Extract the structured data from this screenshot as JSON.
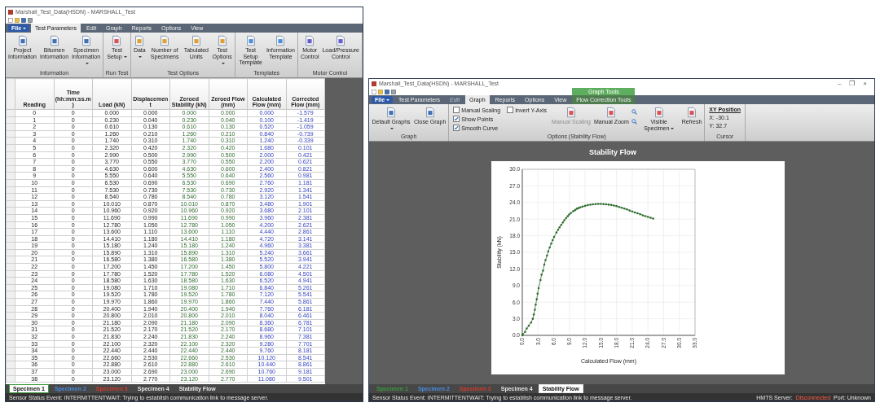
{
  "left_window": {
    "title": "Marshall_Test_Data(HSDN) - MARSHALL_Test",
    "file_menu": "File",
    "tabs": [
      {
        "label": "Test Parameters",
        "selected": true
      },
      {
        "label": "Edit",
        "selected": false
      },
      {
        "label": "Graph",
        "selected": false
      },
      {
        "label": "Reports",
        "selected": false
      },
      {
        "label": "Options",
        "selected": false
      },
      {
        "label": "View",
        "selected": false
      }
    ],
    "ribbon_groups": [
      {
        "label": "Information",
        "items": [
          {
            "kind": "button",
            "label": "Project Information",
            "dropdown": false
          },
          {
            "kind": "button",
            "label": "Bitumen Information",
            "dropdown": false
          },
          {
            "kind": "button",
            "label": "Specimen Information",
            "dropdown": true
          }
        ]
      },
      {
        "label": "Run Test",
        "items": [
          {
            "kind": "button",
            "label": "Test Setup",
            "dropdown": true
          }
        ]
      },
      {
        "label": "Test Options",
        "items": [
          {
            "kind": "button",
            "label": "Data",
            "dropdown": true
          },
          {
            "kind": "button",
            "label": "Number of Specimens",
            "dropdown": false
          },
          {
            "kind": "button",
            "label": "Tabulated Units",
            "dropdown": false
          },
          {
            "kind": "button",
            "label": "Test Options",
            "dropdown": true
          }
        ]
      },
      {
        "label": "Templates",
        "items": [
          {
            "kind": "button",
            "label": "Test Setup Template",
            "dropdown": false
          },
          {
            "kind": "button",
            "label": "Information Template",
            "dropdown": false
          }
        ]
      },
      {
        "label": "Motor Control",
        "items": [
          {
            "kind": "button",
            "label": "Motor Control",
            "dropdown": false
          },
          {
            "kind": "button",
            "label": "Load/Pressure Control",
            "dropdown": false
          }
        ]
      }
    ],
    "table": {
      "columns": [
        {
          "label": "Reading",
          "kind": "raw"
        },
        {
          "label": "Time (hh:mm:ss.m)",
          "kind": "raw"
        },
        {
          "label": "Load (kN)",
          "kind": "raw"
        },
        {
          "label": "Displacement",
          "kind": "raw"
        },
        {
          "label": "Zeroed Stability (kN)",
          "kind": "zeroed"
        },
        {
          "label": "Zeroed Flow (mm)",
          "kind": "zeroed"
        },
        {
          "label": "Calculated Flow (mm)",
          "kind": "computed"
        },
        {
          "label": "Corrected Flow (mm)",
          "kind": "computed"
        }
      ],
      "rows": [
        [
          "0",
          "0",
          "0.000",
          "0.000",
          "0.000",
          "0.000",
          "0.000",
          "-1.579"
        ],
        [
          "1",
          "0",
          "0.230",
          "0.040",
          "0.230",
          "0.040",
          "0.100",
          "-1.419"
        ],
        [
          "2",
          "0",
          "0.610",
          "0.130",
          "0.610",
          "0.130",
          "0.520",
          "-1.059"
        ],
        [
          "3",
          "0",
          "1.260",
          "0.210",
          "1.260",
          "0.210",
          "0.840",
          "-0.739"
        ],
        [
          "4",
          "0",
          "1.740",
          "0.310",
          "1.740",
          "0.310",
          "1.240",
          "-0.339"
        ],
        [
          "5",
          "0",
          "2.320",
          "0.420",
          "2.320",
          "0.420",
          "1.680",
          "0.101"
        ],
        [
          "6",
          "0",
          "2.990",
          "0.500",
          "2.990",
          "0.500",
          "2.000",
          "0.421"
        ],
        [
          "7",
          "0",
          "3.770",
          "0.550",
          "3.770",
          "0.550",
          "2.200",
          "0.621"
        ],
        [
          "8",
          "0",
          "4.630",
          "0.600",
          "4.630",
          "0.600",
          "2.400",
          "0.821"
        ],
        [
          "9",
          "0",
          "5.550",
          "0.640",
          "5.550",
          "0.640",
          "2.560",
          "0.981"
        ],
        [
          "10",
          "0",
          "6.530",
          "0.690",
          "6.530",
          "0.690",
          "2.760",
          "1.181"
        ],
        [
          "11",
          "0",
          "7.530",
          "0.730",
          "7.530",
          "0.730",
          "2.920",
          "1.341"
        ],
        [
          "12",
          "0",
          "8.540",
          "0.780",
          "8.540",
          "0.780",
          "3.120",
          "1.541"
        ],
        [
          "13",
          "0",
          "10.010",
          "0.870",
          "10.010",
          "0.870",
          "3.480",
          "1.901"
        ],
        [
          "14",
          "0",
          "10.960",
          "0.920",
          "10.960",
          "0.920",
          "3.680",
          "2.101"
        ],
        [
          "15",
          "0",
          "11.690",
          "0.990",
          "11.690",
          "0.990",
          "3.960",
          "2.381"
        ],
        [
          "16",
          "0",
          "12.780",
          "1.050",
          "12.780",
          "1.050",
          "4.200",
          "2.621"
        ],
        [
          "17",
          "0",
          "13.600",
          "1.110",
          "13.600",
          "1.110",
          "4.440",
          "2.861"
        ],
        [
          "18",
          "0",
          "14.410",
          "1.180",
          "14.410",
          "1.180",
          "4.720",
          "3.141"
        ],
        [
          "19",
          "0",
          "15.180",
          "1.240",
          "15.180",
          "1.240",
          "4.960",
          "3.381"
        ],
        [
          "20",
          "0",
          "15.890",
          "1.310",
          "15.890",
          "1.310",
          "5.240",
          "3.661"
        ],
        [
          "21",
          "0",
          "16.580",
          "1.380",
          "16.580",
          "1.380",
          "5.520",
          "3.941"
        ],
        [
          "22",
          "0",
          "17.200",
          "1.450",
          "17.200",
          "1.450",
          "5.800",
          "4.221"
        ],
        [
          "23",
          "0",
          "17.780",
          "1.520",
          "17.780",
          "1.520",
          "6.080",
          "4.501"
        ],
        [
          "24",
          "0",
          "18.580",
          "1.630",
          "18.580",
          "1.630",
          "6.520",
          "4.941"
        ],
        [
          "25",
          "0",
          "19.080",
          "1.710",
          "19.080",
          "1.710",
          "6.840",
          "5.261"
        ],
        [
          "26",
          "0",
          "19.520",
          "1.780",
          "19.520",
          "1.780",
          "7.120",
          "5.541"
        ],
        [
          "27",
          "0",
          "19.970",
          "1.860",
          "19.970",
          "1.860",
          "7.440",
          "5.861"
        ],
        [
          "28",
          "0",
          "20.400",
          "1.940",
          "20.400",
          "1.940",
          "7.760",
          "6.181"
        ],
        [
          "29",
          "0",
          "20.800",
          "2.010",
          "20.800",
          "2.010",
          "8.040",
          "6.461"
        ],
        [
          "30",
          "0",
          "21.180",
          "2.090",
          "21.180",
          "2.090",
          "8.360",
          "6.781"
        ],
        [
          "31",
          "0",
          "21.520",
          "2.170",
          "21.520",
          "2.170",
          "8.680",
          "7.101"
        ],
        [
          "32",
          "0",
          "21.830",
          "2.240",
          "21.830",
          "2.240",
          "8.960",
          "7.381"
        ],
        [
          "33",
          "0",
          "22.100",
          "2.320",
          "22.100",
          "2.320",
          "9.280",
          "7.701"
        ],
        [
          "34",
          "0",
          "22.440",
          "2.440",
          "22.440",
          "2.440",
          "9.760",
          "8.181"
        ],
        [
          "35",
          "0",
          "22.660",
          "2.530",
          "22.660",
          "2.530",
          "10.120",
          "8.541"
        ],
        [
          "36",
          "0",
          "22.880",
          "2.610",
          "22.880",
          "2.610",
          "10.440",
          "8.861"
        ],
        [
          "37",
          "0",
          "23.000",
          "2.690",
          "23.000",
          "2.690",
          "10.760",
          "9.181"
        ],
        [
          "38",
          "0",
          "23.120",
          "2.770",
          "23.120",
          "2.770",
          "11.080",
          "9.501"
        ]
      ]
    },
    "sheet_tabs": [
      {
        "label": "Specimen 1",
        "selected": true,
        "color": "#3a9a3a"
      },
      {
        "label": "Specimen 2",
        "selected": false,
        "color": "#4a8be0"
      },
      {
        "label": "Specimen 3",
        "selected": false,
        "color": "#d23a2a"
      },
      {
        "label": "Specimen 4",
        "selected": false,
        "color": "#e6e6e6"
      },
      {
        "label": "Stability Flow",
        "selected": false,
        "color": "#e6e6e6"
      }
    ],
    "status_bar": {
      "text": "Sensor Status Event: INTERMITTENTWAIT: Trying to establish communication link to message server."
    }
  },
  "right_window": {
    "title": "Marshall_Test_Data(HSDN) - MARSHALL_Test",
    "window_controls": [
      "–",
      "❐",
      "×"
    ],
    "file_menu": "File",
    "tabs": [
      {
        "label": "Test Parameters",
        "selected": false,
        "disabled": false
      },
      {
        "label": "Edit",
        "selected": false,
        "disabled": true
      },
      {
        "label": "Graph",
        "selected": true,
        "disabled": false
      },
      {
        "label": "Reports",
        "selected": false,
        "disabled": false
      },
      {
        "label": "Options",
        "selected": false,
        "disabled": false
      },
      {
        "label": "View",
        "selected": false,
        "disabled": false
      },
      {
        "label": "Flow Correction Tools",
        "selected": false,
        "disabled": false,
        "context": "Graph Tools"
      }
    ],
    "ribbon_groups": [
      {
        "label": "Graph",
        "items": [
          {
            "kind": "button",
            "label": "Default Graphs",
            "dropdown": true,
            "disabled": false
          },
          {
            "kind": "button",
            "label": "Close Graph",
            "dropdown": false,
            "disabled": false
          }
        ]
      },
      {
        "label": "Options (Stability Flow)",
        "items": [
          {
            "kind": "stack",
            "items": [
              {
                "kind": "checkbox",
                "label": "Manual Scaling",
                "checked": false
              },
              {
                "kind": "checkbox",
                "label": "Show Points",
                "checked": true
              },
              {
                "kind": "checkbox",
                "label": "Smooth Curve",
                "checked": true
              }
            ]
          },
          {
            "kind": "stack",
            "items": [
              {
                "kind": "checkbox",
                "label": "Invert Y-Axis",
                "checked": false
              }
            ]
          },
          {
            "kind": "button",
            "label": "Manual Scaling",
            "dropdown": false,
            "disabled": true
          },
          {
            "kind": "button",
            "label": "Manual Zoom",
            "dropdown": false,
            "disabled": false
          },
          {
            "kind": "zoom"
          },
          {
            "kind": "button",
            "label": "Visible Specimen",
            "dropdown": true,
            "disabled": false
          },
          {
            "kind": "button",
            "label": "Refresh",
            "dropdown": false,
            "disabled": false
          }
        ]
      },
      {
        "label": "Cursor",
        "items": [
          {
            "kind": "stack",
            "items": [
              {
                "kind": "heading",
                "label": "XY Position"
              },
              {
                "kind": "value",
                "label": "X: -30.1"
              },
              {
                "kind": "value",
                "label": "Y: 32.7"
              }
            ]
          }
        ]
      }
    ],
    "chart_data": {
      "type": "line",
      "title": "Stability Flow",
      "xlabel": "Calculated Flow (mm)",
      "ylabel": "Stability (kN)",
      "x": [
        0,
        0.1,
        0.52,
        0.84,
        1.24,
        1.68,
        2,
        2.2,
        2.4,
        2.56,
        2.76,
        2.92,
        3.12,
        3.48,
        3.68,
        3.96,
        4.2,
        4.44,
        4.72,
        4.96,
        5.24,
        5.52,
        5.8,
        6.08,
        6.52,
        6.84,
        7.12,
        7.44,
        7.76,
        8.04,
        8.36,
        8.68,
        8.96,
        9.28,
        9.76,
        10.12,
        10.44,
        10.76,
        11.08,
        11.5,
        12,
        12.5,
        13,
        13.5,
        14,
        14.5,
        15,
        15.5,
        16,
        16.5,
        17,
        17.5,
        18,
        18.5,
        19,
        19.5,
        20,
        20.5,
        21,
        21.5,
        22,
        22.5,
        23,
        23.5,
        24,
        24.5,
        25
      ],
      "grid": true,
      "series": [
        {
          "color": "#2f6e2f",
          "values": [
            0,
            0.23,
            0.61,
            1.26,
            1.74,
            2.32,
            2.99,
            3.77,
            4.63,
            5.55,
            6.53,
            7.53,
            8.54,
            10.01,
            10.96,
            11.69,
            12.78,
            13.6,
            14.41,
            15.18,
            15.89,
            16.58,
            17.2,
            17.78,
            18.58,
            19.08,
            19.52,
            19.97,
            20.4,
            20.8,
            21.18,
            21.52,
            21.83,
            22.1,
            22.44,
            22.66,
            22.88,
            23,
            23.12,
            23.26,
            23.4,
            23.52,
            23.61,
            23.68,
            23.72,
            23.74,
            23.74,
            23.72,
            23.68,
            23.62,
            23.55,
            23.46,
            23.36,
            23.2,
            23.05,
            22.9,
            22.75,
            22.55,
            22.4,
            22.2,
            22.05,
            21.9,
            21.7,
            21.55,
            21.4,
            21.25,
            21.1
          ]
        }
      ],
      "xlim": [
        0,
        33
      ],
      "ylim": [
        0,
        30
      ],
      "xticks": [
        {
          "value": 0,
          "label": "0.0"
        },
        {
          "value": 3,
          "label": "3.0"
        },
        {
          "value": 6,
          "label": "6.0"
        },
        {
          "value": 9,
          "label": "9.0"
        },
        {
          "value": 12,
          "label": "12.0"
        },
        {
          "value": 15,
          "label": "15.0"
        },
        {
          "value": 18,
          "label": "18.0"
        },
        {
          "value": 21,
          "label": "21.0"
        },
        {
          "value": 24,
          "label": "24.0"
        },
        {
          "value": 27,
          "label": "27.0"
        },
        {
          "value": 30,
          "label": "30.0"
        },
        {
          "value": 33,
          "label": "33.0"
        }
      ],
      "yticks": [
        {
          "value": 0,
          "label": "0.0"
        },
        {
          "value": 3,
          "label": "3.0"
        },
        {
          "value": 6,
          "label": "6.0"
        },
        {
          "value": 9,
          "label": "9.0"
        },
        {
          "value": 12,
          "label": "12.0"
        },
        {
          "value": 15,
          "label": "15.0"
        },
        {
          "value": 18,
          "label": "18.0"
        },
        {
          "value": 21,
          "label": "21.0"
        },
        {
          "value": 24,
          "label": "24.0"
        },
        {
          "value": 27,
          "label": "27.0"
        },
        {
          "value": 30,
          "label": "30.0"
        }
      ]
    },
    "sheet_tabs": [
      {
        "label": "Specimen 1",
        "selected": false,
        "color": "#3a9a3a"
      },
      {
        "label": "Specimen 2",
        "selected": false,
        "color": "#4a8be0"
      },
      {
        "label": "Specimen 3",
        "selected": false,
        "color": "#d23a2a"
      },
      {
        "label": "Specimen 4",
        "selected": false,
        "color": "#e6e6e6"
      },
      {
        "label": "Stability Flow",
        "selected": true,
        "color": "#e6e6e6"
      }
    ],
    "status_bar": {
      "text": "Sensor Status Event: INTERMITTENTWAIT: Trying to establish communication link to message server.",
      "server_label": "HMTS Server:",
      "server_state": "Disconnected",
      "port": "Port: Unknown"
    }
  }
}
